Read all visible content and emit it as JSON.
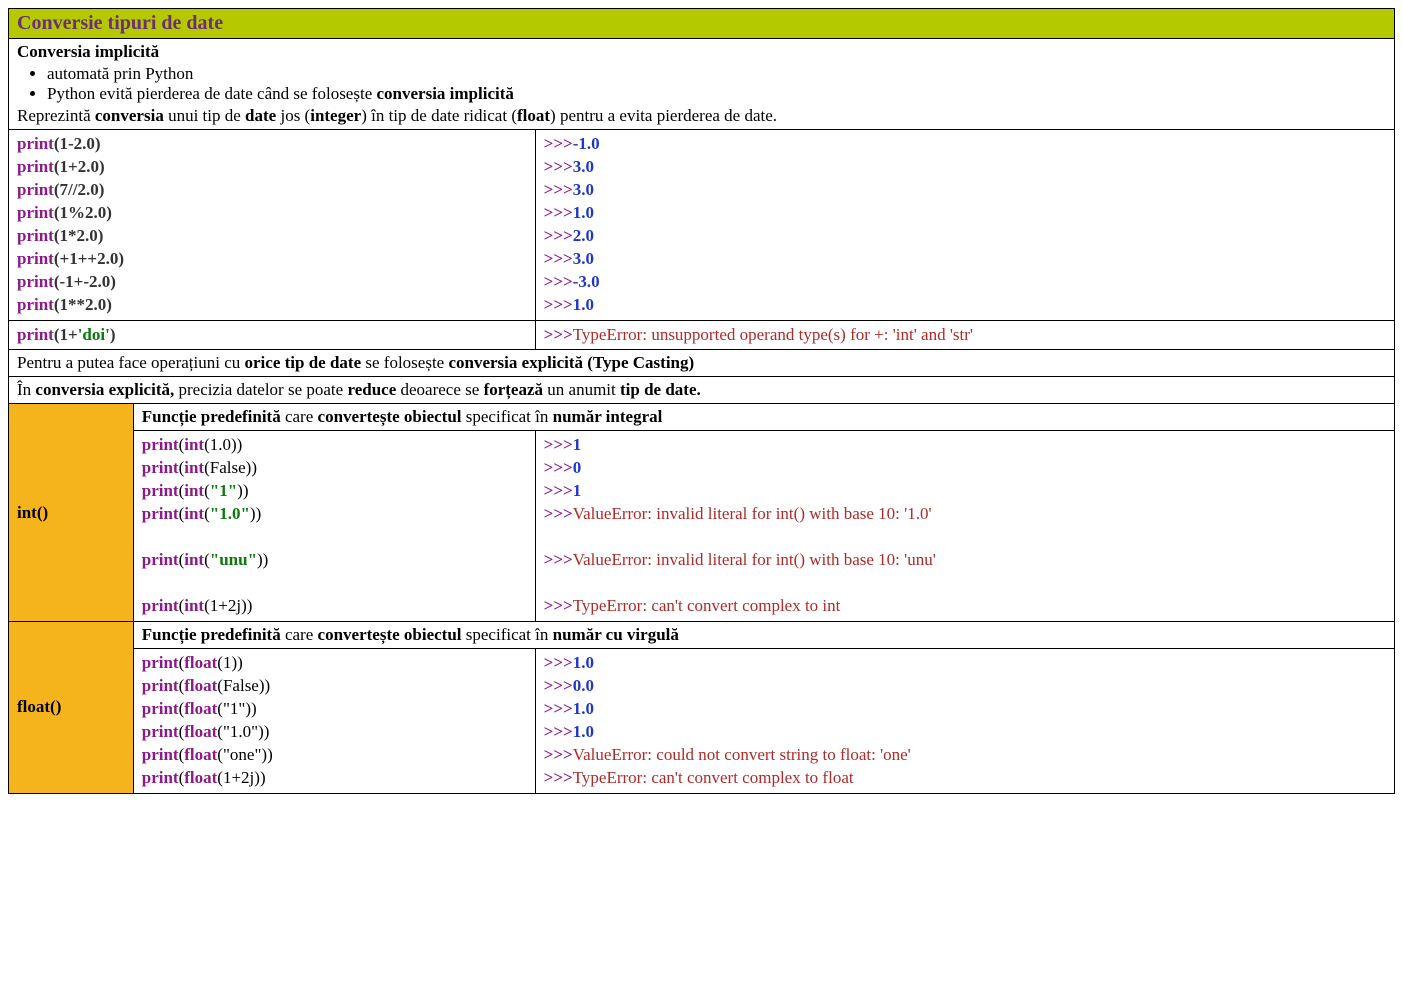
{
  "title": "Conversie tipuri de date",
  "intro": {
    "heading": "Conversia implicită",
    "bullets": [
      "automată prin Python",
      "Python evită pierderea de date când se folosește"
    ],
    "bullet2_bold": "conversia implicită",
    "desc_p1": "Reprezintă",
    "desc_b1": "conversia",
    "desc_p2": "unui tip de",
    "desc_b2": "date",
    "desc_p3": "jos (",
    "desc_b3": "integer",
    "desc_p4": ") în tip de date ridicat (",
    "desc_b4": "float",
    "desc_p5": ") pentru a evita pierderea de date."
  },
  "implicit": {
    "code": [
      "1-2.0",
      "1+2.0",
      "7//2.0",
      "1%2.0",
      "1*2.0",
      "+1++2.0",
      "-1+-2.0",
      "1**2.0"
    ],
    "out": [
      "-1.0",
      "3.0",
      "3.0",
      "1.0",
      "2.0",
      "3.0",
      "-3.0",
      "1.0"
    ]
  },
  "errline": {
    "pre": "1+",
    "str": "'doi'",
    "err": "TypeError: unsupported operand type(s) for +: 'int' and 'str'"
  },
  "explicit_intro": {
    "p1": "Pentru a putea face operațiuni cu",
    "b1": "orice tip de date",
    "p2": "se folosește",
    "b2": "conversia explicită (Type Casting)"
  },
  "explicit_note": {
    "p1": "În",
    "b1": "conversia explicită,",
    "p2": "precizia datelor se poate",
    "b2": "reduce",
    "p3": "deoarece se",
    "b3": "forțează",
    "p4": "un anumit",
    "b4": "tip de date."
  },
  "int_sec": {
    "name": "int()",
    "desc_b1": "Funcție predefinită",
    "desc_p1": "care",
    "desc_b2": "convertește obiectul",
    "desc_p2": "specificat în",
    "desc_b3": "număr integral",
    "rows": [
      {
        "arg": "1.0",
        "argtype": "plain",
        "out": "1",
        "outtype": "ok"
      },
      {
        "arg": "False",
        "argtype": "plain",
        "out": "0",
        "outtype": "ok"
      },
      {
        "arg": "\"1\"",
        "argtype": "str",
        "out": "1",
        "outtype": "ok"
      },
      {
        "arg": "\"1.0\"",
        "argtype": "str",
        "out": "ValueError: invalid literal for int() with base 10: '1.0'",
        "outtype": "err"
      },
      {
        "argtype": "gap"
      },
      {
        "arg": "\"unu\"",
        "argtype": "str",
        "out": "ValueError: invalid literal for int() with base 10: 'unu'",
        "outtype": "err"
      },
      {
        "argtype": "gap"
      },
      {
        "arg": "1+2j",
        "argtype": "plain",
        "out": "TypeError: can't convert complex to int",
        "outtype": "err"
      }
    ]
  },
  "float_sec": {
    "name": "float()",
    "desc_b1": "Funcție predefinită",
    "desc_p1": "care",
    "desc_b2": "convertește obiectul",
    "desc_p2": "specificat în",
    "desc_b3": "număr cu virgulă",
    "rows": [
      {
        "arg": "1",
        "argtype": "plain",
        "out": "1.0",
        "outtype": "ok"
      },
      {
        "arg": "False",
        "argtype": "plain",
        "out": "0.0",
        "outtype": "ok"
      },
      {
        "arg": "\"1\"",
        "argtype": "plainstr",
        "out": "1.0",
        "outtype": "ok"
      },
      {
        "arg": "\"1.0\"",
        "argtype": "plainstr",
        "out": "1.0",
        "outtype": "ok"
      },
      {
        "arg": "\"one\"",
        "argtype": "plainstr",
        "out": "ValueError: could not convert string to float: 'one'",
        "outtype": "err"
      },
      {
        "arg": "1+2j",
        "argtype": "plain",
        "out": "TypeError: can't convert complex to float",
        "outtype": "err"
      }
    ]
  },
  "print": "print",
  "prompt": ">>>"
}
